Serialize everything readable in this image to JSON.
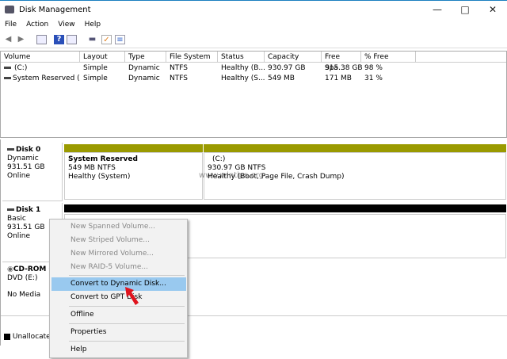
{
  "window": {
    "title": "Disk Management",
    "controls": [
      "minimize",
      "maximize",
      "close"
    ]
  },
  "menu": [
    "File",
    "Action",
    "View",
    "Help"
  ],
  "toolbar": [
    "back-icon",
    "forward-icon",
    "console-tree-icon",
    "help-icon",
    "action-pane-icon",
    "connect-icon",
    "check-icon",
    "properties-icon"
  ],
  "volume_list": {
    "columns": [
      "Volume",
      "Layout",
      "Type",
      "File System",
      "Status",
      "Capacity",
      "Free Spa...",
      "% Free"
    ],
    "rows": [
      [
        "(C:)",
        "Simple",
        "Dynamic",
        "NTFS",
        "Healthy (B...",
        "930.97 GB",
        "915.38 GB",
        "98 %"
      ],
      [
        "System Reserved (...",
        "Simple",
        "Dynamic",
        "NTFS",
        "Healthy (S...",
        "549 MB",
        "171 MB",
        "31 %"
      ]
    ]
  },
  "disks": [
    {
      "name": "Disk 0",
      "type": "Dynamic",
      "size": "931.51 GB",
      "state": "Online",
      "partitions": [
        {
          "name": "System Reserved",
          "detail": "549 MB NTFS",
          "status": "Healthy (System)"
        },
        {
          "name": "(C:)",
          "detail": "930.97 GB NTFS",
          "status": "Healthy (Boot, Page File, Crash Dump)"
        }
      ]
    },
    {
      "name": "Disk 1",
      "type": "Basic",
      "size": "931.51 GB",
      "state": "Online"
    },
    {
      "name": "CD-ROM 0",
      "type": "DVD (E:)",
      "state": "No Media"
    }
  ],
  "legend": {
    "unallocated": "Unallocated"
  },
  "watermark": "www.wintips.org",
  "context_menu": {
    "items": [
      {
        "label": "New Spanned Volume...",
        "enabled": false
      },
      {
        "label": "New Striped Volume...",
        "enabled": false
      },
      {
        "label": "New Mirrored Volume...",
        "enabled": false
      },
      {
        "label": "New RAID-5 Volume...",
        "enabled": false
      },
      {
        "label": "Convert to Dynamic Disk...",
        "enabled": true,
        "highlighted": true
      },
      {
        "label": "Convert to GPT Disk",
        "enabled": true
      },
      {
        "label": "Offline",
        "enabled": true
      },
      {
        "label": "Properties",
        "enabled": true
      },
      {
        "label": "Help",
        "enabled": true
      }
    ]
  },
  "colors": {
    "dynamic_bar": "#9a9a00",
    "basic_bar": "#000000",
    "highlight": "#99c9ef",
    "arrow": "#e0141e"
  }
}
